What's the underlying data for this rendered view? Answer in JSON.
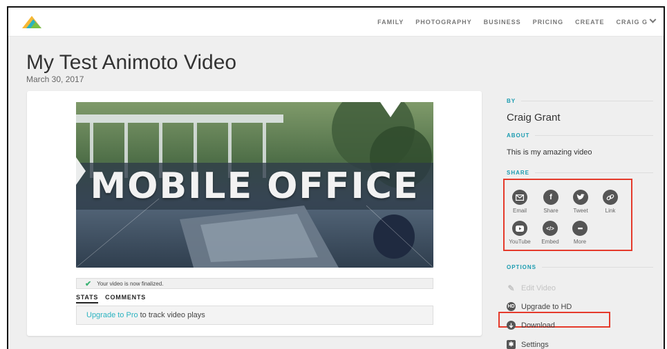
{
  "nav": {
    "items": [
      "FAMILY",
      "PHOTOGRAPHY",
      "BUSINESS",
      "PRICING",
      "CREATE",
      "CRAIG G"
    ]
  },
  "video": {
    "title": "My Test Animoto Video",
    "date": "March 30, 2017",
    "overlay_text": "MOBILE OFFICE"
  },
  "notice": "Your video is now finalized.",
  "tabs": [
    "STATS",
    "COMMENTS"
  ],
  "stats": {
    "link": "Upgrade to Pro",
    "text": "to track video plays"
  },
  "sidebar": {
    "by_label": "BY",
    "author": "Craig Grant",
    "about_label": "ABOUT",
    "about": "This is my amazing video",
    "share_label": "SHARE",
    "share": [
      {
        "label": "Email",
        "icon": "email-icon"
      },
      {
        "label": "Share",
        "icon": "facebook-icon"
      },
      {
        "label": "Tweet",
        "icon": "twitter-icon"
      },
      {
        "label": "Link",
        "icon": "link-icon"
      },
      {
        "label": "YouTube",
        "icon": "youtube-icon"
      },
      {
        "label": "Embed",
        "icon": "embed-icon"
      },
      {
        "label": "More",
        "icon": "more-icon"
      }
    ],
    "options_label": "OPTIONS",
    "options": [
      {
        "label": "Edit Video",
        "icon": "pencil-icon",
        "disabled": true
      },
      {
        "label": "Upgrade to HD",
        "icon": "hd-icon",
        "disabled": false
      },
      {
        "label": "Download",
        "icon": "download-icon",
        "disabled": false
      },
      {
        "label": "Settings",
        "icon": "gear-icon",
        "disabled": false
      }
    ]
  },
  "colors": {
    "accent": "#2bb3c0",
    "highlight": "#e53a2b",
    "background": "#efefef"
  }
}
